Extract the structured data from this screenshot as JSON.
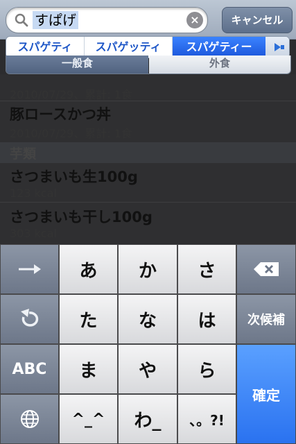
{
  "search": {
    "query": "すぱげ",
    "cancel_label": "キャンセル"
  },
  "candidates": [
    {
      "label": "スパゲティ",
      "selected": false
    },
    {
      "label": "スパゲッティ",
      "selected": false
    },
    {
      "label": "スパゲティー",
      "selected": true
    }
  ],
  "segments": [
    {
      "label": "一般食",
      "selected": true
    },
    {
      "label": "外食",
      "selected": false
    }
  ],
  "list": {
    "rows": [
      {
        "title": "",
        "detail": "2010/07/29、累計: 1食"
      },
      {
        "title": "豚ロースかつ丼",
        "detail": "2010/07/29、累計: 1食"
      }
    ],
    "section": "芋類",
    "section_rows": [
      {
        "title": "さつまいも生100g",
        "detail": "123 kcal"
      },
      {
        "title": "さつまいも干し100g",
        "detail": "303 kcal"
      }
    ]
  },
  "keyboard": {
    "row1": [
      "あ",
      "か",
      "さ"
    ],
    "row2": [
      "た",
      "な",
      "は"
    ],
    "row3": [
      "ま",
      "や",
      "ら"
    ],
    "row4": [
      "^_^",
      "わ_",
      "、。?!"
    ],
    "left_abc": "ABC",
    "next_candidate": "次候補",
    "confirm": "確定"
  },
  "colors": {
    "accent": "#2a72f0",
    "search_bar": "#9eaabb",
    "keyboard_bg": "#3a3a3c"
  }
}
